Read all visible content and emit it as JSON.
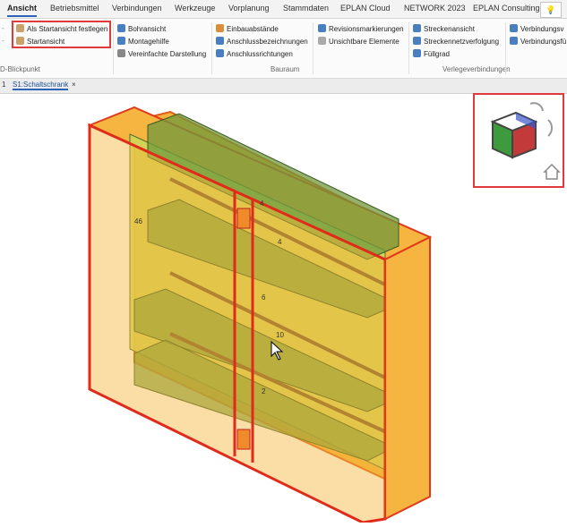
{
  "tabs": [
    "Ansicht",
    "Betriebsmittel",
    "Verbindungen",
    "Werkzeuge",
    "Vorplanung",
    "Stammdaten",
    "EPLAN Cloud",
    "NETWORK 2023",
    "EPLAN Consulting"
  ],
  "active_tab": "Ansicht",
  "help_icon": "lightbulb-icon",
  "ribbon": {
    "group1": {
      "items": [
        "Als Startansicht festlegen",
        "Startansicht"
      ],
      "label": "D-Blickpunkt"
    },
    "group2": {
      "items": [
        "Bohransicht",
        "Montagehilfe",
        "Vereinfachte Darstellung"
      ]
    },
    "group3": {
      "items": [
        "Einbauabstände",
        "Anschlussbezeichnungen",
        "Anschlussrichtungen"
      ],
      "label": "Bauraum"
    },
    "group4": {
      "items": [
        "Revisionsmarkierungen",
        "Unsichtbare Elemente"
      ]
    },
    "group5": {
      "items": [
        "Streckenansicht",
        "Streckennetzverfolgung",
        "Füllgrad"
      ],
      "label": "Verlegeverbindungen"
    },
    "group6": {
      "items": [
        "Verbindungsv",
        "Verbindungsfü"
      ]
    },
    "left_markers": [
      "-",
      "-"
    ]
  },
  "doc_tabs": {
    "number": "1",
    "active": "S1:Schaltschrank",
    "close": "×"
  },
  "model_labels": [
    "46",
    "4",
    "4",
    "6",
    "10",
    "2"
  ],
  "colors": {
    "highlight": "#e03a3a",
    "cabinet": "#f0a020",
    "panel": "#d6d84a",
    "rail": "#5f8f3a"
  }
}
